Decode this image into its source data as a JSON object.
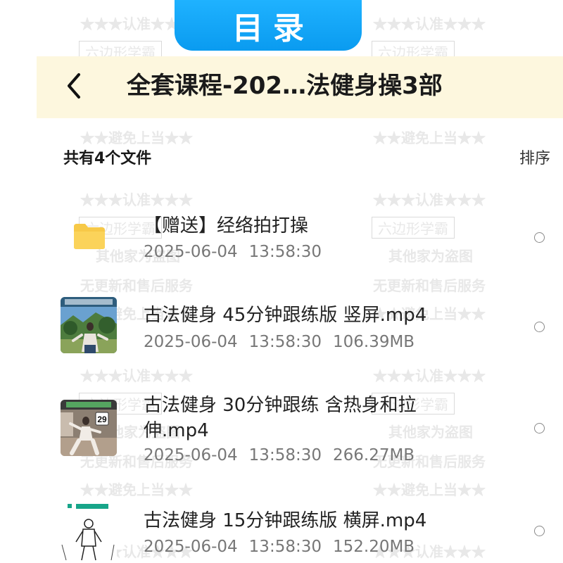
{
  "banner": {
    "text": "目录"
  },
  "header": {
    "title": "全套课程-202…法健身操3部"
  },
  "list_header": {
    "count_text": "共有4个文件",
    "sort_label": "排序"
  },
  "files": [
    {
      "name": "【赠送】经络拍打操",
      "date": "2025-06-04",
      "time": "13:58:30",
      "size": "",
      "type": "folder",
      "icon": "folder-icon"
    },
    {
      "name": "古法健身 45分钟跟练版 竖屏.mp4",
      "date": "2025-06-04",
      "time": "13:58:30",
      "size": "106.39MB",
      "type": "video"
    },
    {
      "name_line1": "古法健身 30分钟跟练 含热身和拉",
      "name_line2": "伸.mp4",
      "date": "2025-06-04",
      "time": "13:58:30",
      "size": "266.27MB",
      "type": "video"
    },
    {
      "name": "古法健身 15分钟跟练版 横屏.mp4",
      "date": "2025-06-04",
      "time": "13:58:30",
      "size": "152.20MB",
      "type": "video"
    }
  ],
  "thumbnails": {
    "video3_counter": "29"
  },
  "watermarks": [
    "★★★认准★★★",
    "六边形学霸",
    "其他家为盗图",
    "无更新和售后服务",
    "★★避免上当★★"
  ],
  "colors": {
    "banner": "#0a9bf0",
    "header_bg": "#fdf7de",
    "folder": "#f7c948"
  }
}
